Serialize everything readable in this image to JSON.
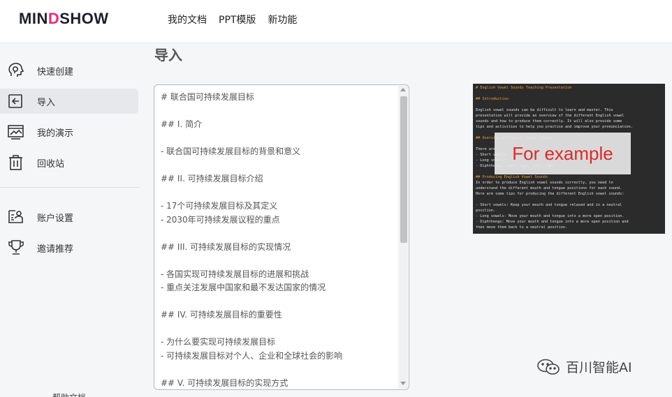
{
  "header": {
    "logo_pre": "MIN",
    "logo_mid": "D",
    "logo_post": "SHOW",
    "nav": [
      "我的文档",
      "PPT模版",
      "新功能"
    ]
  },
  "sidebar": {
    "items": [
      {
        "label": "快速创建",
        "icon": "brain-bulb-icon"
      },
      {
        "label": "导入",
        "icon": "import-icon"
      },
      {
        "label": "我的演示",
        "icon": "presentation-icon"
      },
      {
        "label": "回收站",
        "icon": "trash-icon"
      },
      {
        "label": "账户设置",
        "icon": "account-icon"
      },
      {
        "label": "邀请推荐",
        "icon": "trophy-icon"
      }
    ],
    "bottom_partial": "帮助文档"
  },
  "main": {
    "title": "导入",
    "editor_lines": [
      "# 联合国可持续发展目标",
      "",
      "## I. 简介",
      "",
      "- 联合国可持续发展目标的背景和意义",
      "",
      "## II. 可持续发展目标介绍",
      "",
      "- 17个可持续发展目标及其定义",
      "- 2030年可持续发展议程的重点",
      "",
      "## III. 可持续发展目标的实现情况",
      "",
      "- 各国实现可持续发展目标的进展和挑战",
      "- 重点关注发展中国家和最不发达国家的情况",
      "",
      "## IV. 可持续发展目标的重要性",
      "",
      "- 为什么要实现可持续发展目标",
      "- 可持续发展目标对个人、企业和全球社会的影响",
      "",
      "## V. 可持续发展目标的实现方式"
    ]
  },
  "example": {
    "overlay": "For example",
    "lines": [
      {
        "cls": "h",
        "text": "# English Vowel Sounds Teaching Presentation"
      },
      {
        "cls": "t",
        "text": ""
      },
      {
        "cls": "h",
        "text": "## Introduction"
      },
      {
        "cls": "t",
        "text": ""
      },
      {
        "cls": "t",
        "text": "English vowel sounds can be difficult to learn and master. This"
      },
      {
        "cls": "t",
        "text": "presentation will provide an overview of the different English vowel"
      },
      {
        "cls": "t",
        "text": "sounds and how to produce them correctly. It will also provide some"
      },
      {
        "cls": "t",
        "text": "tips and activities to help you practice and improve your pronunciation."
      },
      {
        "cls": "t",
        "text": ""
      },
      {
        "cls": "h",
        "text": "## Overview of English Vowel Sounds"
      },
      {
        "cls": "t",
        "text": ""
      },
      {
        "cls": "t",
        "text": "There are ..."
      },
      {
        "cls": "t",
        "text": "- Short vowels: ..."
      },
      {
        "cls": "t",
        "text": "- Long vowels: ..."
      },
      {
        "cls": "t",
        "text": "- Diphthongs: /eɪ/, /aɪ/, /ɔɪ/, /aʊ/"
      },
      {
        "cls": "t",
        "text": ""
      },
      {
        "cls": "h",
        "text": "## Producing English Vowel Sounds"
      },
      {
        "cls": "t",
        "text": "In order to produce English vowel sounds correctly, you need to"
      },
      {
        "cls": "t",
        "text": "understand the different mouth and tongue positions for each sound."
      },
      {
        "cls": "t",
        "text": "Here are some tips for producing the different English vowel sounds:"
      },
      {
        "cls": "t",
        "text": ""
      },
      {
        "cls": "t",
        "text": "- Short vowels: Keep your mouth and tongue relaxed and in a neutral"
      },
      {
        "cls": "t",
        "text": "position."
      },
      {
        "cls": "t",
        "text": "- Long vowels: Move your mouth and tongue into a more open position."
      },
      {
        "cls": "t",
        "text": "- Diphthongs: Move your mouth and tongue into a more open position and"
      },
      {
        "cls": "t",
        "text": "then move them back to a neutral position."
      }
    ]
  },
  "watermark": {
    "text": "百川智能AI"
  }
}
